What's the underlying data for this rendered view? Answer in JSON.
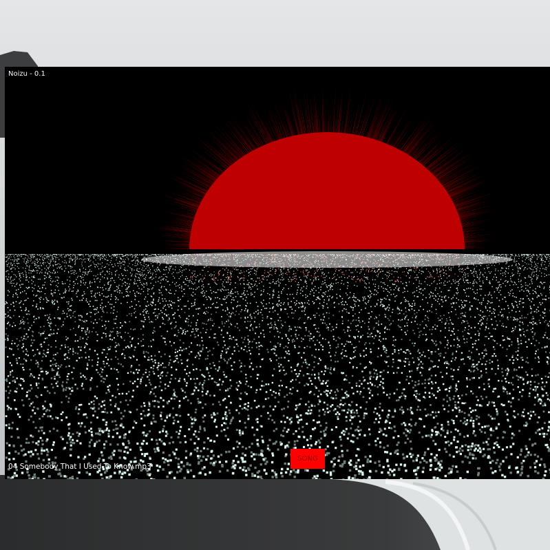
{
  "window": {
    "title": "Noizu - 0.1"
  },
  "player": {
    "current_track": "04 Somebody That I Used To Know.mp3",
    "song_button_label": "SONG"
  },
  "colors": {
    "sun": "#bf0000",
    "sun_rays": "#cc0000",
    "particles": "#d8f5ec",
    "particles_warm": "#ff6a5a",
    "button_bg": "#ff0000",
    "window_bg": "#000000"
  }
}
